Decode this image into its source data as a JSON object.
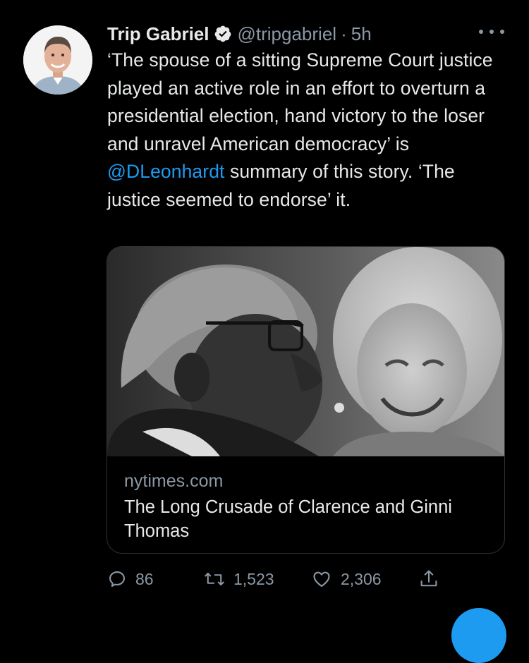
{
  "tweet": {
    "author": {
      "display_name": "Trip Gabriel",
      "handle": "@tripgabriel",
      "separator": "·",
      "time": "5h",
      "verified": true,
      "avatar_icon": "author-photo"
    },
    "text": {
      "part1": "‘The spouse of a sitting Supreme Court justice played an active role in an effort to overturn a presidential election, hand victory to the loser and unravel American democracy’ is ",
      "mention": "@DLeonhardt",
      "part2": " summary of this story. ‘The justice seemed to endorse’ it."
    },
    "card": {
      "domain": "nytimes.com",
      "title": "The Long Crusade of Clarence and Ginni Thomas",
      "image_icon": "article-photo"
    },
    "actions": {
      "replies": "86",
      "retweets": "1,523",
      "likes": "2,306"
    }
  },
  "colors": {
    "background": "#000000",
    "text": "#e7e9ea",
    "secondary": "#8b98a5",
    "accent": "#1d9bf0",
    "border": "#2f3336"
  }
}
